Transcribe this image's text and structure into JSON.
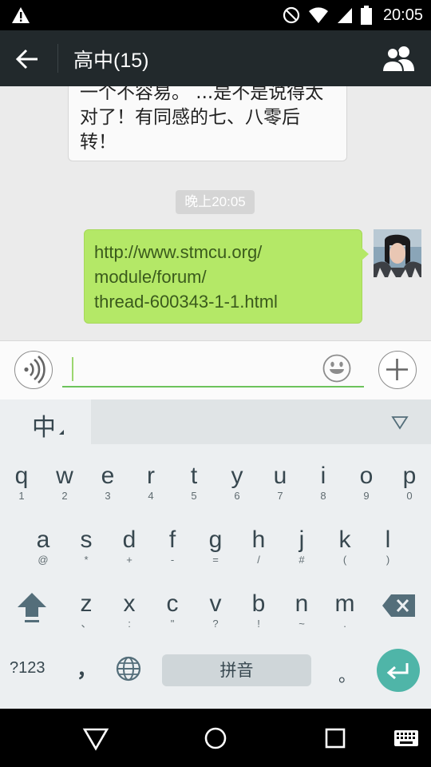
{
  "status_bar": {
    "time": "20:05"
  },
  "header": {
    "title": "高中(15)"
  },
  "messages": {
    "incoming": {
      "lines": [
        "一个不容易。 ...是不是说得太",
        "对了！有同感的七、八零后",
        "转！"
      ]
    },
    "timestamp": "晚上20:05",
    "outgoing": {
      "lines": [
        "http://www.stmcu.org/",
        "module/forum/",
        "thread-600343-1-1.html"
      ]
    }
  },
  "input": {
    "value": ""
  },
  "keyboard": {
    "language": "中",
    "row1": [
      {
        "main": "q",
        "sub": "1"
      },
      {
        "main": "w",
        "sub": "2"
      },
      {
        "main": "e",
        "sub": "3"
      },
      {
        "main": "r",
        "sub": "4"
      },
      {
        "main": "t",
        "sub": "5"
      },
      {
        "main": "y",
        "sub": "6"
      },
      {
        "main": "u",
        "sub": "7"
      },
      {
        "main": "i",
        "sub": "8"
      },
      {
        "main": "o",
        "sub": "9"
      },
      {
        "main": "p",
        "sub": "0"
      }
    ],
    "row2": [
      {
        "main": "a",
        "sub": "@"
      },
      {
        "main": "s",
        "sub": "*"
      },
      {
        "main": "d",
        "sub": "+"
      },
      {
        "main": "f",
        "sub": "-"
      },
      {
        "main": "g",
        "sub": "="
      },
      {
        "main": "h",
        "sub": "/"
      },
      {
        "main": "j",
        "sub": "#"
      },
      {
        "main": "k",
        "sub": "("
      },
      {
        "main": "l",
        "sub": ")"
      }
    ],
    "row3": [
      {
        "main": "z",
        "sub": "、"
      },
      {
        "main": "x",
        "sub": ":"
      },
      {
        "main": "c",
        "sub": "\""
      },
      {
        "main": "v",
        "sub": "?"
      },
      {
        "main": "b",
        "sub": "!"
      },
      {
        "main": "n",
        "sub": "~"
      },
      {
        "main": "m",
        "sub": "."
      }
    ],
    "symbols_label": "?123",
    "comma_label": "，",
    "space_label": "拼音",
    "period_label": "。"
  },
  "colors": {
    "title_bar": "#22292c",
    "outgoing_bubble": "#b4e867",
    "enter_key": "#4fb5a8"
  }
}
